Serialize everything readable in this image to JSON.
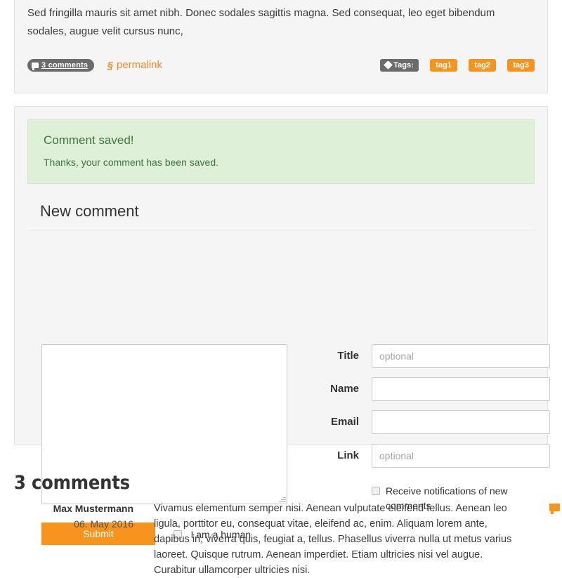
{
  "post": {
    "text": "Sed fringilla mauris sit amet nibh. Donec sodales sagittis magna. Sed consequat, leo eget bibendum sodales, augue velit cursus nunc,",
    "comments_badge": "3 comments",
    "permalink_label": "permalink",
    "permalink_icon": "link-icon",
    "comments_badge_icon": "speech-bubble-icon",
    "tags_label": "Tags:",
    "tags_icon": "tag-icon",
    "tags": [
      "tag1",
      "tag2",
      "tag3"
    ]
  },
  "alert": {
    "title": "Comment saved!",
    "body": "Thanks, your comment has been saved.",
    "background_color": "#dff0d8",
    "border_color": "#d6e9c6",
    "text_color": "#3c763d"
  },
  "form": {
    "heading": "New comment",
    "textarea_value": "",
    "textarea_placeholder": "",
    "fields": [
      {
        "label": "Title",
        "value": "",
        "placeholder": "optional"
      },
      {
        "label": "Name",
        "value": "",
        "placeholder": ""
      },
      {
        "label": "Email",
        "value": "",
        "placeholder": ""
      },
      {
        "label": "Link",
        "value": "",
        "placeholder": "optional"
      }
    ],
    "notify_label": "Receive notifications of new comments",
    "submit_label": "Submit",
    "human_label": "I am a human"
  },
  "comments": {
    "heading": "3 comments",
    "items": [
      {
        "author": "Max Mustermann",
        "date": "06. May 2016",
        "body": "Vivamus elementum semper nisi. Aenean vulputate eleifend tellus. Aenean leo ligula, porttitor eu, consequat vitae, eleifend ac, enim. Aliquam lorem ante, dapibus in, viverra quis, feugiat a, tellus. Phasellus viverra nulla ut metus varius laoreet. Quisque rutrum. Aenean imperdiet. Etiam ultricies nisi vel augue. Curabitur ullamcorper ultricies nisi.",
        "reply_icon": "speech-bubble-icon"
      }
    ]
  },
  "colors": {
    "accent_orange": "#f7941e",
    "link_orange": "#f08a26",
    "badge_gray": "#6b6b6b",
    "panel_bg": "#f5f5f5",
    "panel_border": "#e3e3e3"
  }
}
